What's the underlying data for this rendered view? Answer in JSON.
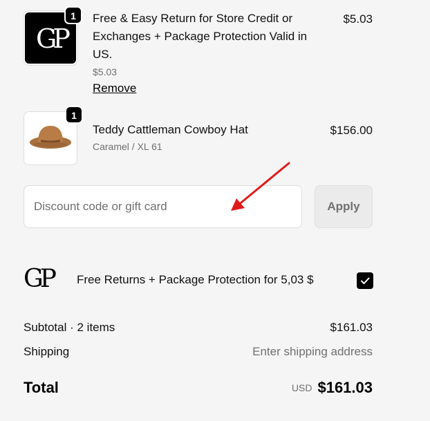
{
  "cart_items": [
    {
      "quantity": "1",
      "logo_text": "GP",
      "title_lines": [
        "Free & Easy Return for Store Credit or",
        "Exchanges + Package Protection Valid in",
        "US."
      ],
      "subtitle": "$5.03",
      "price": "$5.03",
      "remove_label": "Remove"
    },
    {
      "quantity": "1",
      "image": "cowboy-hat",
      "title": "Teddy Cattleman Cowboy Hat",
      "subtitle": "Caramel / XL 61",
      "price": "$156.00"
    }
  ],
  "discount": {
    "placeholder": "Discount code or gift card",
    "apply_label": "Apply"
  },
  "protection": {
    "logo_text": "GP",
    "label": "Free Returns + Package Protection for 5,03 $",
    "checked": true
  },
  "summary": {
    "subtotal_label": "Subtotal · 2 items",
    "subtotal_value": "$161.03",
    "shipping_label": "Shipping",
    "shipping_value": "Enter shipping address",
    "total_label": "Total",
    "currency": "USD",
    "total_value": "$161.03"
  },
  "colors": {
    "background": "#f5f5f5",
    "annotation_arrow": "#e01b1b",
    "muted_text": "#707070"
  }
}
